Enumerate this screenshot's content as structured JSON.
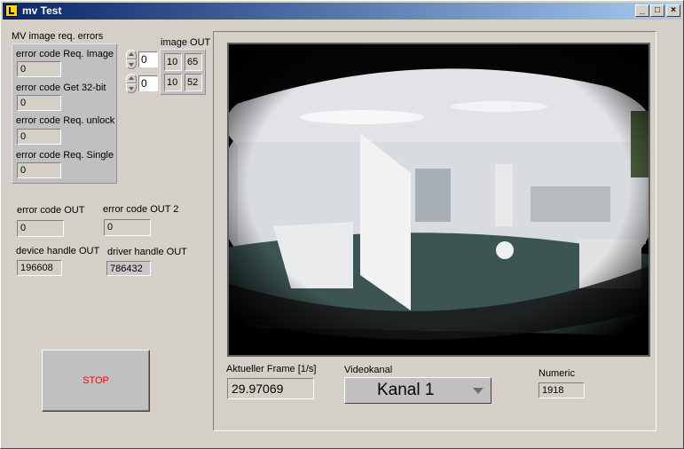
{
  "window": {
    "title": "mv Test",
    "minimize": "_",
    "maximize": "□",
    "close": "×"
  },
  "errors_cluster": {
    "label": "MV image req. errors",
    "items": [
      {
        "label": "error code Req. Image",
        "value": "0"
      },
      {
        "label": "error code Get 32-bit",
        "value": "0"
      },
      {
        "label": "error code Req. unlock",
        "value": "0"
      },
      {
        "label": "error code Req. Single",
        "value": "0"
      }
    ]
  },
  "image_out": {
    "label": "image OUT",
    "index0": "0",
    "index1": "0",
    "cells": [
      [
        "10",
        "65"
      ],
      [
        "10",
        "52"
      ]
    ]
  },
  "indicators": {
    "error_code_out": {
      "label": "error code OUT",
      "value": "0"
    },
    "error_code_out2": {
      "label": "error code OUT 2",
      "value": "0"
    },
    "device_handle": {
      "label": "device handle OUT",
      "value": "196608"
    },
    "driver_handle": {
      "label": "driver handle OUT",
      "value": "786432"
    }
  },
  "stop_button": {
    "label": "STOP"
  },
  "bottom": {
    "frame_rate": {
      "label": "Aktueller Frame [1/s]",
      "value": "29.97069"
    },
    "videokanal": {
      "label": "Videokanal",
      "value": "Kanal 1"
    },
    "numeric": {
      "label": "Numeric",
      "value": "1918"
    }
  },
  "colors": {
    "background": "#d4d0c8",
    "titlebar_start": "#0a246a",
    "titlebar_end": "#a6caf0",
    "stop_text": "#ff0000"
  }
}
